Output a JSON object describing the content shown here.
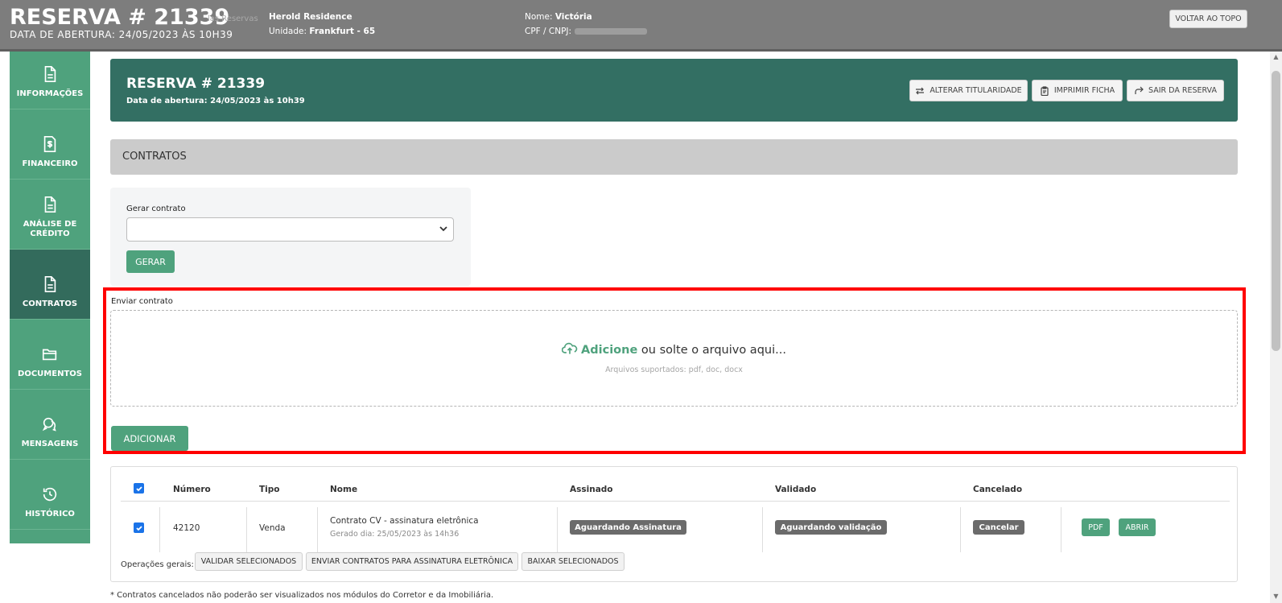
{
  "topbar": {
    "title": "RESERVA # 21339",
    "subtitle": "DATA DE ABERTURA: 24/05/2023 ÀS 10H39",
    "ghost_text": "las Reservas",
    "empreendimento": "Herold Residence",
    "unidade_label": "Unidade:",
    "unidade_value": "Frankfurt - 65",
    "nome_label": "Nome:",
    "nome_value": "Victória",
    "cpf_label": "CPF / CNPJ:",
    "back_to_top": "VOLTAR AO TOPO"
  },
  "sidebar": {
    "items": [
      {
        "label": "INFORMAÇÕES",
        "icon": "document-icon"
      },
      {
        "label": "FINANCEIRO",
        "icon": "money-document-icon"
      },
      {
        "label": "ANÁLISE DE CRÉDITO",
        "icon": "document-icon"
      },
      {
        "label": "CONTRATOS",
        "icon": "document-icon",
        "active": true
      },
      {
        "label": "DOCUMENTOS",
        "icon": "folder-icon"
      },
      {
        "label": "MENSAGENS",
        "icon": "chat-icon"
      },
      {
        "label": "HISTÓRICO",
        "icon": "history-icon"
      }
    ]
  },
  "header": {
    "title": "RESERVA # 21339",
    "subtitle": "Data de abertura: 24/05/2023 às 10h39",
    "btn_alterar": "ALTERAR TITULARIDADE",
    "btn_imprimir": "IMPRIMIR FICHA",
    "btn_sair": "SAIR DA RESERVA"
  },
  "section": {
    "title": "CONTRATOS"
  },
  "generate": {
    "label": "Gerar contrato",
    "selected": "",
    "button": "GERAR"
  },
  "upload": {
    "label": "Enviar contrato",
    "action": "Adicione",
    "text": " ou solte o arquivo aqui...",
    "hint": "Arquivos suportados: pdf, doc, docx",
    "button": "ADICIONAR"
  },
  "table": {
    "headers": {
      "numero": "Número",
      "tipo": "Tipo",
      "nome": "Nome",
      "assinado": "Assinado",
      "validado": "Validado",
      "cancelado": "Cancelado"
    },
    "rows": [
      {
        "numero": "42120",
        "tipo": "Venda",
        "nome": "Contrato CV - assinatura eletrônica",
        "gerado": "Gerado dia: 25/05/2023 às 14h36",
        "assinado": "Aguardando Assinatura",
        "validado": "Aguardando validação",
        "cancelado": "Cancelar",
        "btn_pdf": "PDF",
        "btn_abrir": "ABRIR"
      }
    ],
    "ops_label": "Operações gerais:",
    "op_validar": "VALIDAR SELECIONADOS",
    "op_enviar": "ENVIAR CONTRATOS PARA ASSINATURA ELETRÔNICA",
    "op_baixar": "BAIXAR SELECIONADOS"
  },
  "footnote": "* Contratos cancelados não poderão ser visualizados nos módulos do Corretor e da Imobiliária.",
  "colors": {
    "brand_green": "#4fa27d",
    "header_teal": "#336f63",
    "active_sidebar": "#336b5c",
    "highlight_red": "#ff0000"
  }
}
